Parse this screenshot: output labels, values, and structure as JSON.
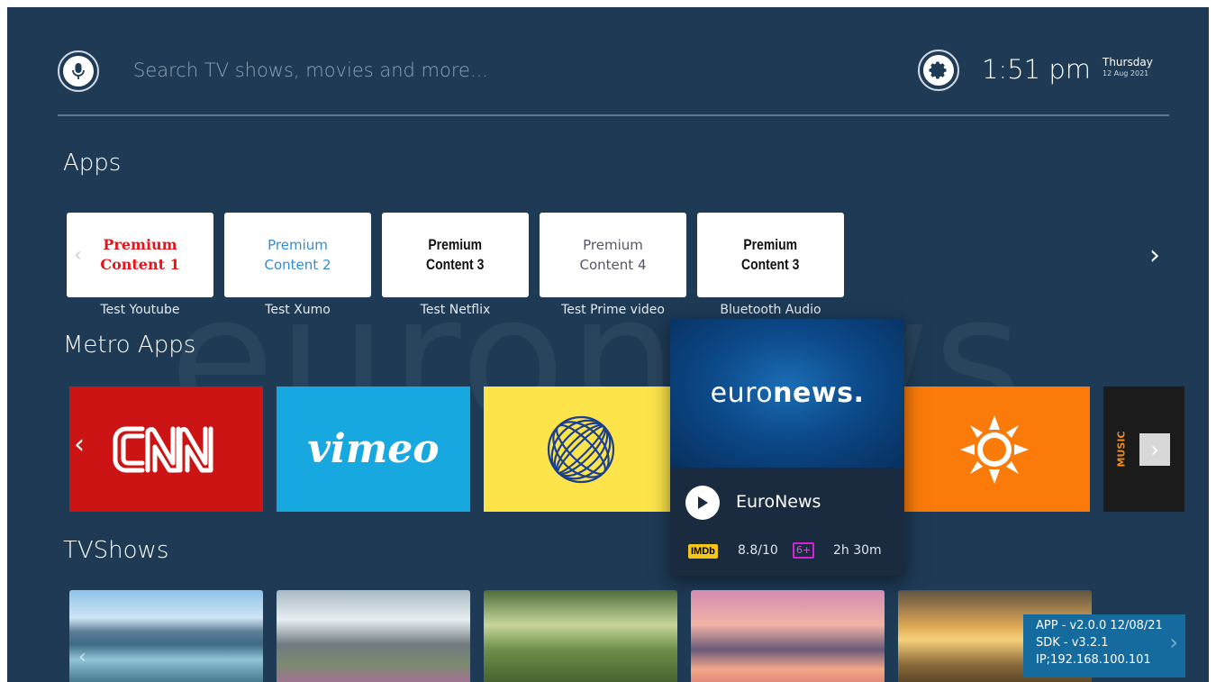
{
  "search": {
    "placeholder": "Search TV shows, movies and more..."
  },
  "status": {
    "time": "1:51 pm",
    "day": "Thursday",
    "date": "12 Aug 2021"
  },
  "apps": {
    "title": "Apps",
    "items": [
      {
        "card": [
          "Premium",
          "Content 1"
        ],
        "label": "Test Youtube",
        "color": "#e8131b"
      },
      {
        "card": [
          "Premium",
          "Content 2"
        ],
        "label": "Test Xumo",
        "color": "#2d8fd5"
      },
      {
        "card": [
          "Premium",
          "Content 3"
        ],
        "label": "Test Netflix",
        "color": "#111111"
      },
      {
        "card": [
          "Premium",
          "Content 4"
        ],
        "label": "Test Prime video",
        "color": "#555566"
      },
      {
        "card": [
          "Premium",
          "Content 3"
        ],
        "label": "Bluetooth Audio",
        "color": "#111111"
      }
    ]
  },
  "metro": {
    "title": "Metro Apps",
    "tiles": [
      {
        "name": "CNN",
        "color": "#cc1414"
      },
      {
        "name": "vimeo",
        "color": "#18a8e0"
      },
      {
        "name": "globe",
        "color": "#fde44a"
      },
      {
        "name": "weather",
        "color": "#fb7b0a"
      },
      {
        "name": "MUSIC",
        "color": "#1b1b1b"
      }
    ],
    "featured": {
      "logo_prefix": "euro",
      "logo_bold": "news",
      "logo_suffix": ".",
      "name": "EuroNews",
      "imdb_badge": "IMDb",
      "rating": "8.8/10",
      "age": "6+",
      "duration": "2h 30m"
    }
  },
  "tvshows": {
    "title": "TVShows"
  },
  "info": {
    "app": "APP - v2.0.0 12/08/21",
    "sdk": "SDK - v3.2.1",
    "ip": "IP;192.168.100.101"
  },
  "watermark": "euronews."
}
